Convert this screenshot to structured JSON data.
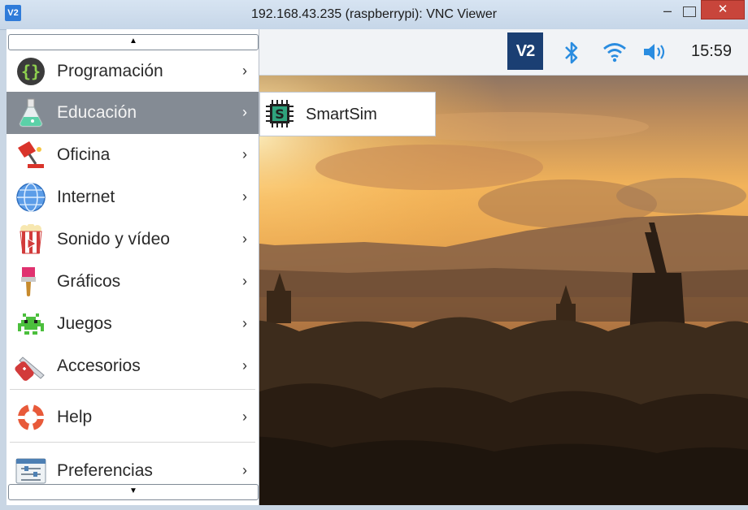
{
  "window": {
    "app_icon_text": "V2",
    "title": "192.168.43.235 (raspberrypi): VNC Viewer",
    "minimize_glyph": "–",
    "close_glyph": "✕"
  },
  "taskbar": {
    "vnc_tray_text": "V2",
    "tray_icons": [
      "vnc-icon",
      "bluetooth-icon",
      "wifi-icon",
      "volume-icon"
    ],
    "clock": "15:59"
  },
  "menu": {
    "scroll_up_glyph": "▲",
    "scroll_down_glyph": "▼",
    "arrow_glyph": "›",
    "items": [
      {
        "label": "Programación",
        "icon": "programming-braces-icon"
      },
      {
        "label": "Educación",
        "icon": "education-flask-icon",
        "active": true
      },
      {
        "label": "Oficina",
        "icon": "office-lamp-icon"
      },
      {
        "label": "Internet",
        "icon": "internet-globe-icon"
      },
      {
        "label": "Sonido y vídeo",
        "icon": "sound-video-popcorn-icon"
      },
      {
        "label": "Gráficos",
        "icon": "graphics-brush-icon"
      },
      {
        "label": "Juegos",
        "icon": "games-invader-icon"
      },
      {
        "label": "Accesorios",
        "icon": "accessories-knife-icon"
      },
      {
        "label": "Help",
        "icon": "help-lifebuoy-icon"
      },
      {
        "label": "Preferencias",
        "icon": "preferences-sliders-icon"
      }
    ]
  },
  "submenu": {
    "items": [
      {
        "label": "SmartSim",
        "icon": "smartsim-chip-icon",
        "icon_text": "S"
      }
    ]
  },
  "colors": {
    "active_item_bg": "#848b94",
    "vnc_tray_bg": "#1b3f73",
    "tray_icon_blue": "#2a8ce0",
    "close_button": "#c8453b"
  }
}
